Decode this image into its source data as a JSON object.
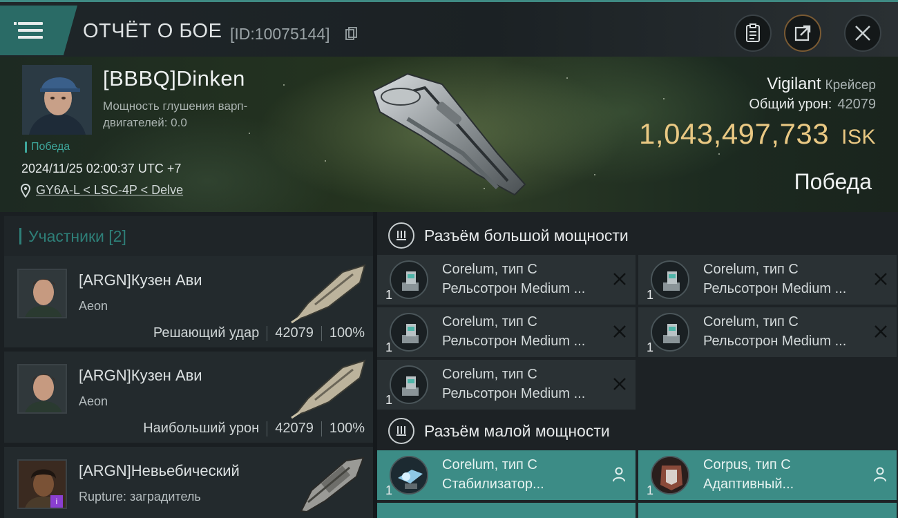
{
  "header": {
    "menu_icon": "hamburger-menu-icon",
    "title": "ОТЧЁТ О БОЕ",
    "report_id": "[ID:10075144]",
    "copy_icon": "copy-icon",
    "buttons": [
      "clipboard-icon",
      "share-icon",
      "close-icon"
    ]
  },
  "victim": {
    "name": "[BBBQ]Dinken",
    "warp_text": "Мощность глушения варп-двигателей: 0.0",
    "status_small": "Победа",
    "datetime": "2024/11/25 02:00:37 UTC +7",
    "location": "GY6A-L < LSC-4P < Delve",
    "ship_name": "Vigilant",
    "ship_class": "Крейсер",
    "damage_label": "Общий урон:",
    "damage_value": "42079",
    "isk_value": "1,043,497,733",
    "isk_unit": "ISK",
    "result": "Победа"
  },
  "participants": {
    "title": "Участники [2]",
    "items": [
      {
        "name": "[ARGN]Кузен Ави",
        "ship": "Aeon",
        "role": "Решающий удар",
        "damage": "42079",
        "percent": "100%"
      },
      {
        "name": "[ARGN]Кузен Ави",
        "ship": "Aeon",
        "role": "Наибольший урон",
        "damage": "42079",
        "percent": "100%"
      },
      {
        "name": "[ARGN]Невьебический",
        "ship": "Rupture: заградитель",
        "badge": "i"
      }
    ]
  },
  "fittings": {
    "high_title": "Разъём большой мощности",
    "low_title": "Разъём малой мощности",
    "high_modules": [
      {
        "qty": "1",
        "name": "Corelum, тип C",
        "desc": "Рельсотрон Medium ..."
      },
      {
        "qty": "1",
        "name": "Corelum, тип C",
        "desc": "Рельсотрон Medium ..."
      },
      {
        "qty": "1",
        "name": "Corelum, тип C",
        "desc": "Рельсотрон Medium ..."
      },
      {
        "qty": "1",
        "name": "Corelum, тип C",
        "desc": "Рельсотрон Medium ..."
      },
      {
        "qty": "1",
        "name": "Corelum, тип C",
        "desc": "Рельсотрон Medium ..."
      }
    ],
    "low_modules": [
      {
        "qty": "1",
        "name": "Corelum, тип C",
        "desc": "Стабилизатор..."
      },
      {
        "qty": "1",
        "name": "Corpus, тип C",
        "desc": "Адаптивный..."
      }
    ]
  },
  "colors": {
    "accent_teal": "#3ea79c",
    "isk_gold": "#e9c883",
    "active_module": "#3c8c86"
  }
}
